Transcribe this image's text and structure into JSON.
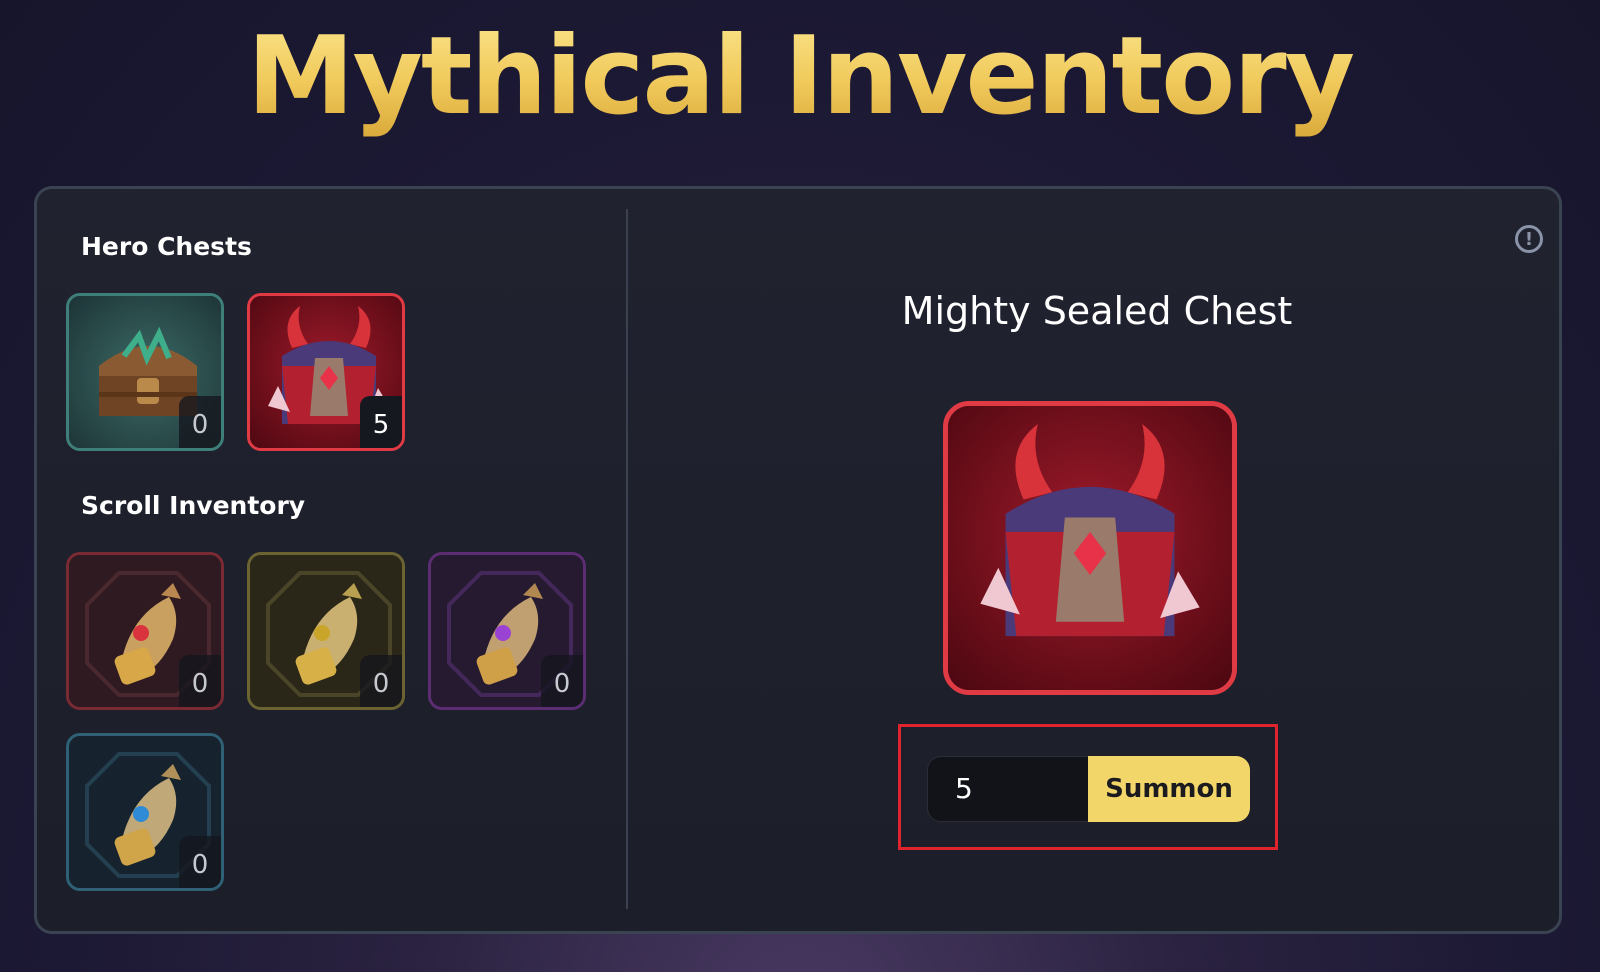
{
  "page_title": "Mythical Inventory",
  "hero_chests": {
    "title": "Hero Chests",
    "items": [
      {
        "name": "Forest Chest",
        "count": "0",
        "border": "#3f7f7a",
        "active": false
      },
      {
        "name": "Mighty Sealed Chest",
        "count": "5",
        "border": "#e03a44",
        "active": true
      }
    ]
  },
  "scroll_inventory": {
    "title": "Scroll Inventory",
    "items": [
      {
        "name": "Red Scroll",
        "count": "0",
        "border": "#7a2a33",
        "gem": "#d9333d"
      },
      {
        "name": "Gold Scroll",
        "count": "0",
        "border": "#6b6432",
        "gem": "#c9a62a"
      },
      {
        "name": "Purple Scroll",
        "count": "0",
        "border": "#5c2d73",
        "gem": "#9a42d3"
      },
      {
        "name": "Blue Scroll",
        "count": "0",
        "border": "#2e6175",
        "gem": "#2f8bd6"
      }
    ]
  },
  "detail": {
    "chest_name": "Mighty Sealed Chest",
    "quantity": "5",
    "summon_label": "Summon"
  },
  "icons": {
    "info": "info-icon"
  },
  "colors": {
    "accent": "#f2d669",
    "title_gold": "#f2cf63",
    "highlight_red": "#e0242e"
  }
}
